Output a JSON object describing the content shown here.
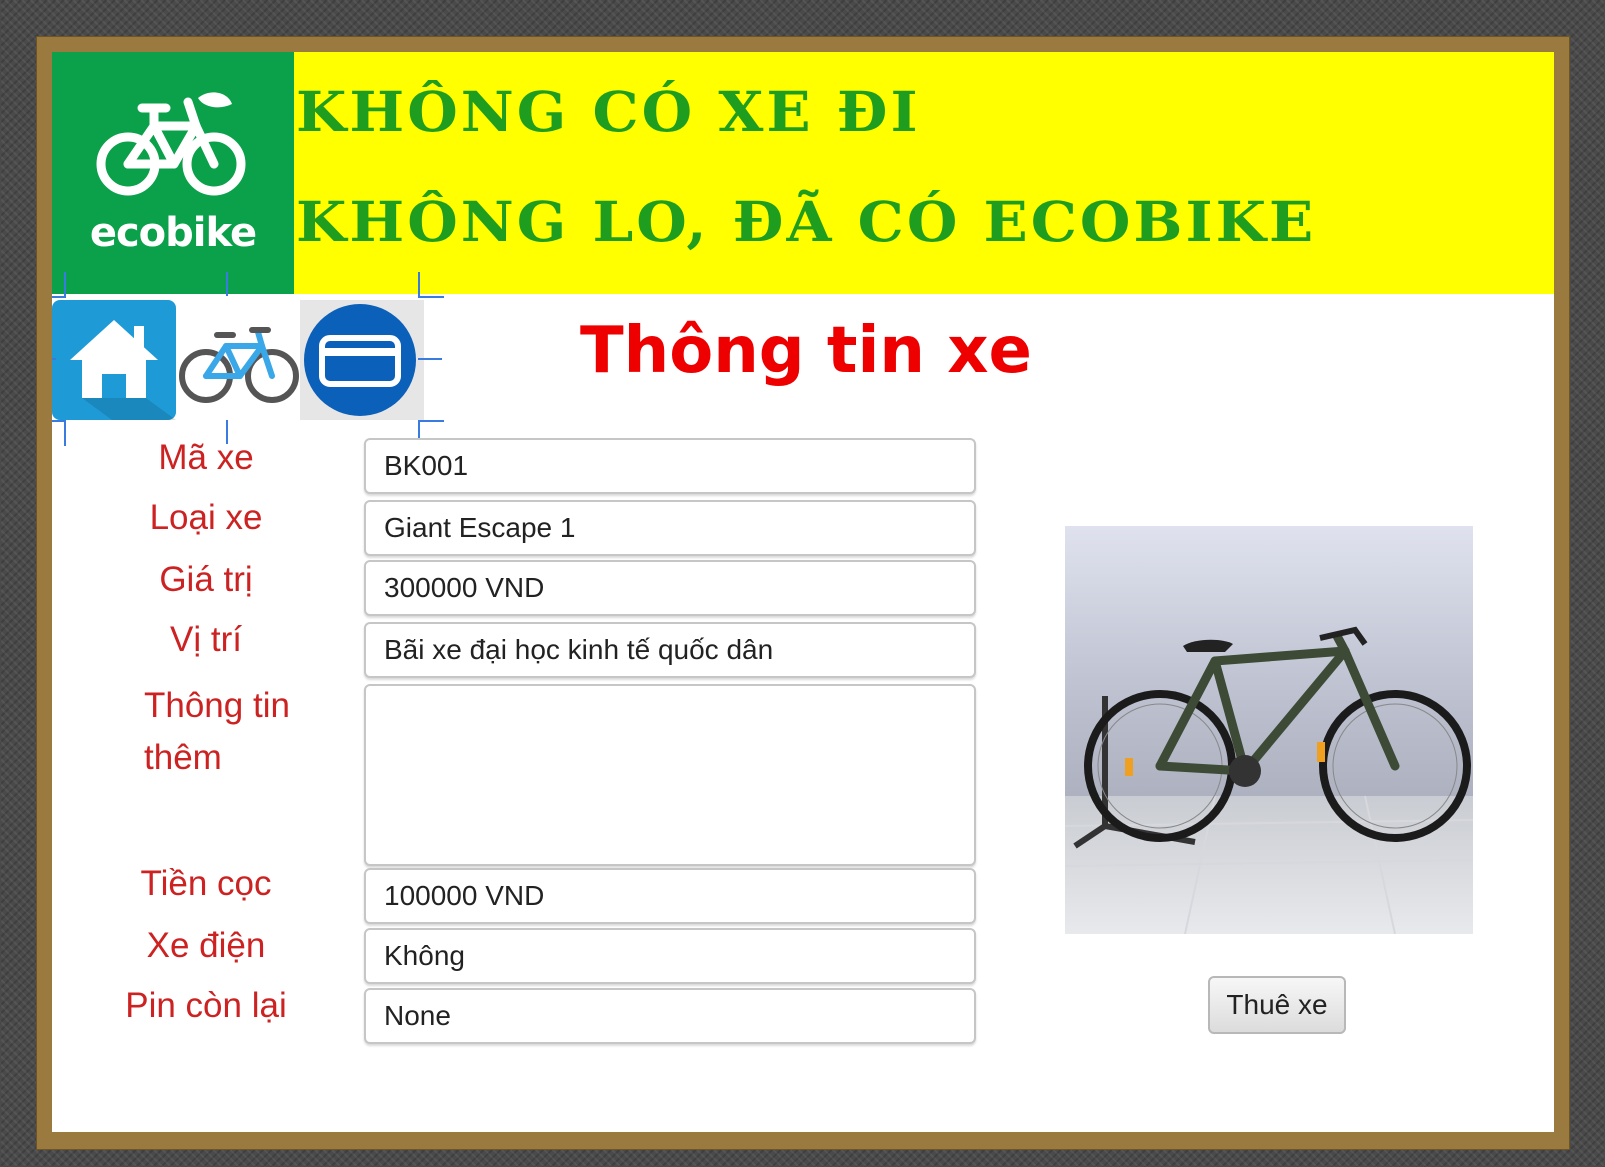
{
  "banner": {
    "logo_text": "ecobike",
    "slogan_line1": "KHÔNG CÓ XE ĐI",
    "slogan_line2": "KHÔNG LO, ĐÃ CÓ ECOBIKE",
    "colors": {
      "banner_bg": "#ffff00",
      "logo_bg": "#0aa14a",
      "slogan": "#1f9d1f"
    }
  },
  "nav": {
    "icons": [
      "house-icon",
      "bicycle-icon",
      "card-icon"
    ]
  },
  "page": {
    "title": "Thông tin xe",
    "title_color": "#ee0000"
  },
  "form": {
    "fields": [
      {
        "label": "Mã xe",
        "value": "BK001"
      },
      {
        "label": "Loại xe",
        "value": "Giant Escape 1"
      },
      {
        "label": "Giá trị",
        "value": "300000 VND"
      },
      {
        "label": "Vị trí",
        "value": "Bãi xe đại học kinh tế quốc dân"
      },
      {
        "label": "Thông tin thêm",
        "value": ""
      },
      {
        "label": "Tiền cọc",
        "value": "100000 VND"
      },
      {
        "label": "Xe điện",
        "value": "Không"
      },
      {
        "label": "Pin còn lại",
        "value": "None"
      }
    ],
    "label_color": "#cc2222"
  },
  "actions": {
    "rent_label": "Thuê xe"
  }
}
